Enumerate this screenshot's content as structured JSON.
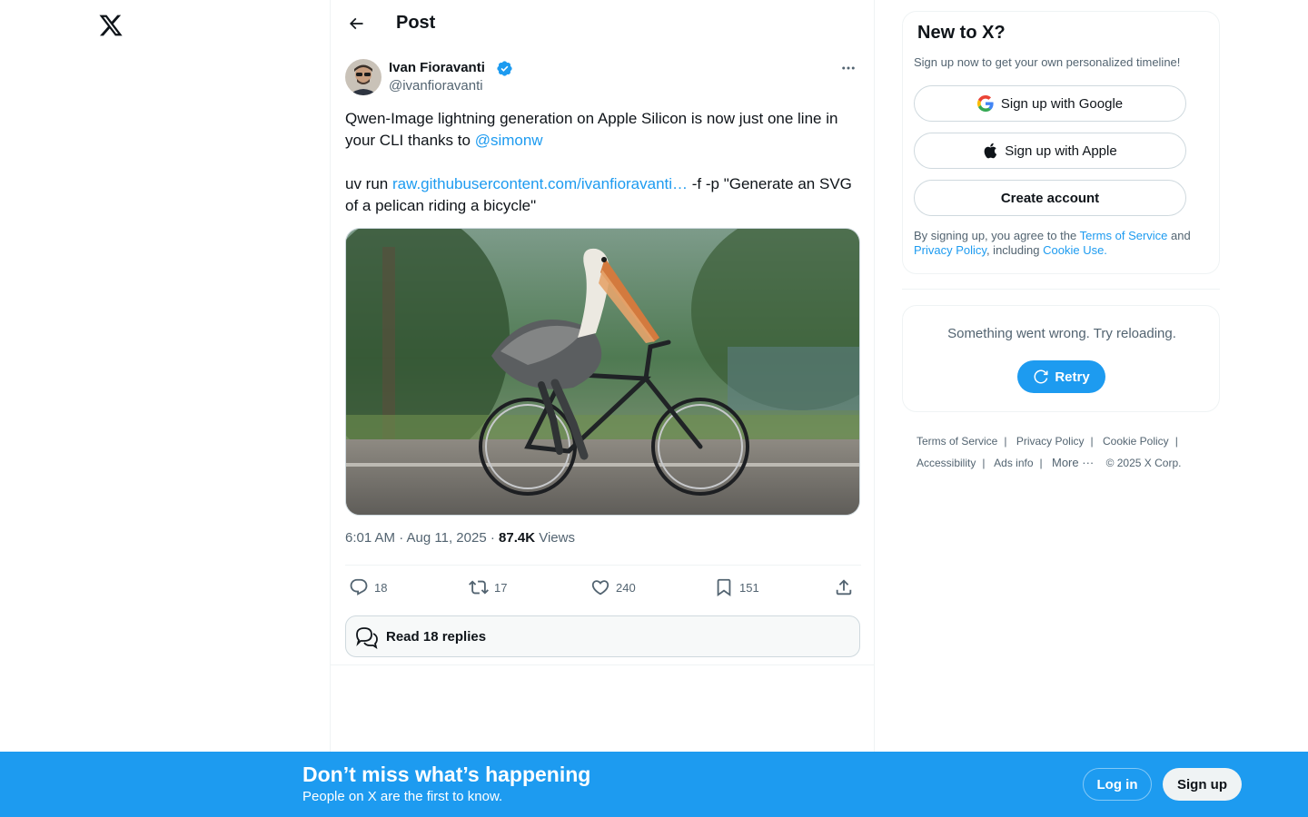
{
  "nav": {
    "logo_icon": "x-logo-icon"
  },
  "header": {
    "title": "Post",
    "back_icon": "arrow-left-icon"
  },
  "post": {
    "author_name": "Ivan Fioravanti",
    "author_handle": "@ivanfioravanti",
    "verified": true,
    "text_line1_prefix": "Qwen-Image lightning generation on Apple Silicon is now just one line in your CLI thanks to ",
    "mention": "@simonw",
    "text_line2_prefix": "uv run ",
    "link": "raw.githubusercontent.com/ivanfioravanti…",
    "text_line2_suffix": " -f -p \"Generate an SVG of a pelican riding a bicycle\"",
    "image_alt": "Pelican riding a bicycle",
    "time": "6:01 AM · Aug 11, 2025",
    "separator": " · ",
    "views_count": "87.4K",
    "views_label": " Views",
    "replies": "18",
    "reposts": "17",
    "likes": "240",
    "bookmarks": "151",
    "read_replies_label": "Read 18 replies"
  },
  "signup": {
    "title": "New to X?",
    "subtitle": "Sign up now to get your own personalized timeline!",
    "google_label": "Sign up with Google",
    "apple_label": "Sign up with Apple",
    "create_label": "Create account",
    "legal_prefix": "By signing up, you agree to the ",
    "terms": "Terms of Service",
    "legal_and": " and",
    "privacy": "Privacy Policy",
    "legal_including": ", including ",
    "cookie": "Cookie Use."
  },
  "error": {
    "message": "Something went wrong. Try reloading.",
    "retry_label": "Retry"
  },
  "footer": {
    "links": [
      "Terms of Service",
      "Privacy Policy",
      "Cookie Policy",
      "Accessibility",
      "Ads info"
    ],
    "more": "More",
    "copyright": "© 2025 X Corp."
  },
  "bottom_bar": {
    "title": "Don’t miss what’s happening",
    "subtitle": "People on X are the first to know.",
    "login_label": "Log in",
    "signup_label": "Sign up"
  },
  "colors": {
    "accent": "#1d9bf0",
    "text": "#0f1419",
    "muted": "#536471",
    "border": "#eff3f4"
  }
}
